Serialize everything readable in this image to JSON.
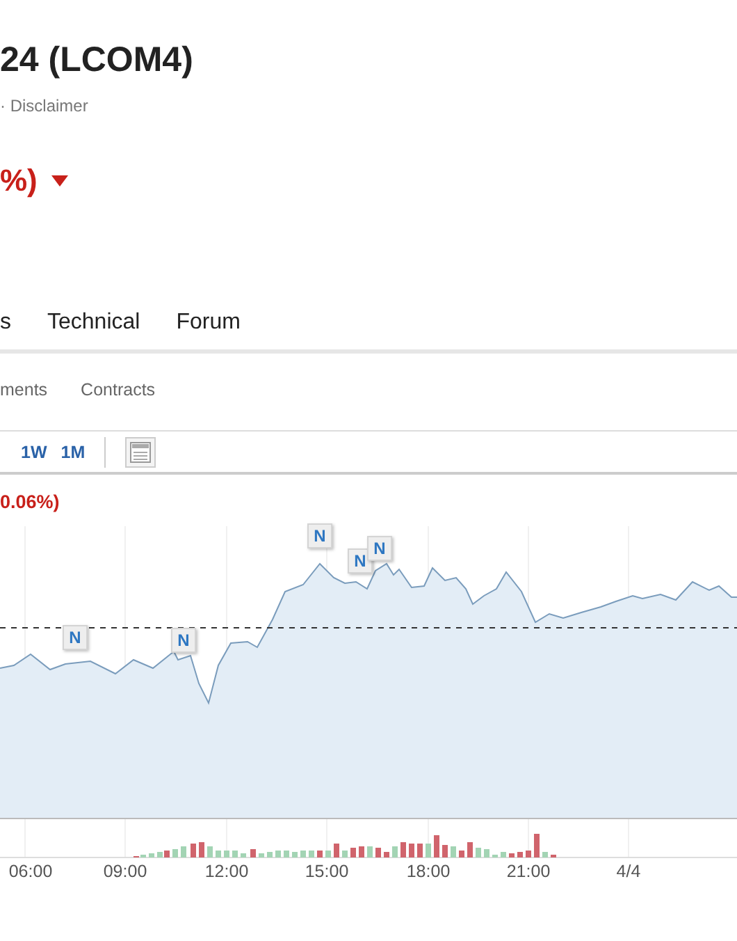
{
  "header": {
    "title": "24 (LCOM4)",
    "subtitle": "· Disclaimer",
    "change": "%)",
    "falling": true
  },
  "tabs": [
    {
      "label": "s",
      "selected": false
    },
    {
      "label": "Technical",
      "selected": false
    },
    {
      "label": "Forum",
      "selected": false
    }
  ],
  "subtabs": [
    {
      "label": "ments",
      "selected": false
    },
    {
      "label": "Contracts",
      "selected": false
    }
  ],
  "ranges": [
    {
      "label": "1W",
      "selected": false
    },
    {
      "label": "1M",
      "selected": false
    }
  ],
  "chart": {
    "change": "0.06%)",
    "news_markers": [
      "N",
      "N",
      "N",
      "N",
      "N"
    ],
    "x_labels": [
      "06:00",
      "09:00",
      "12:00",
      "15:00",
      "18:00",
      "21:00",
      "4/4"
    ]
  }
}
